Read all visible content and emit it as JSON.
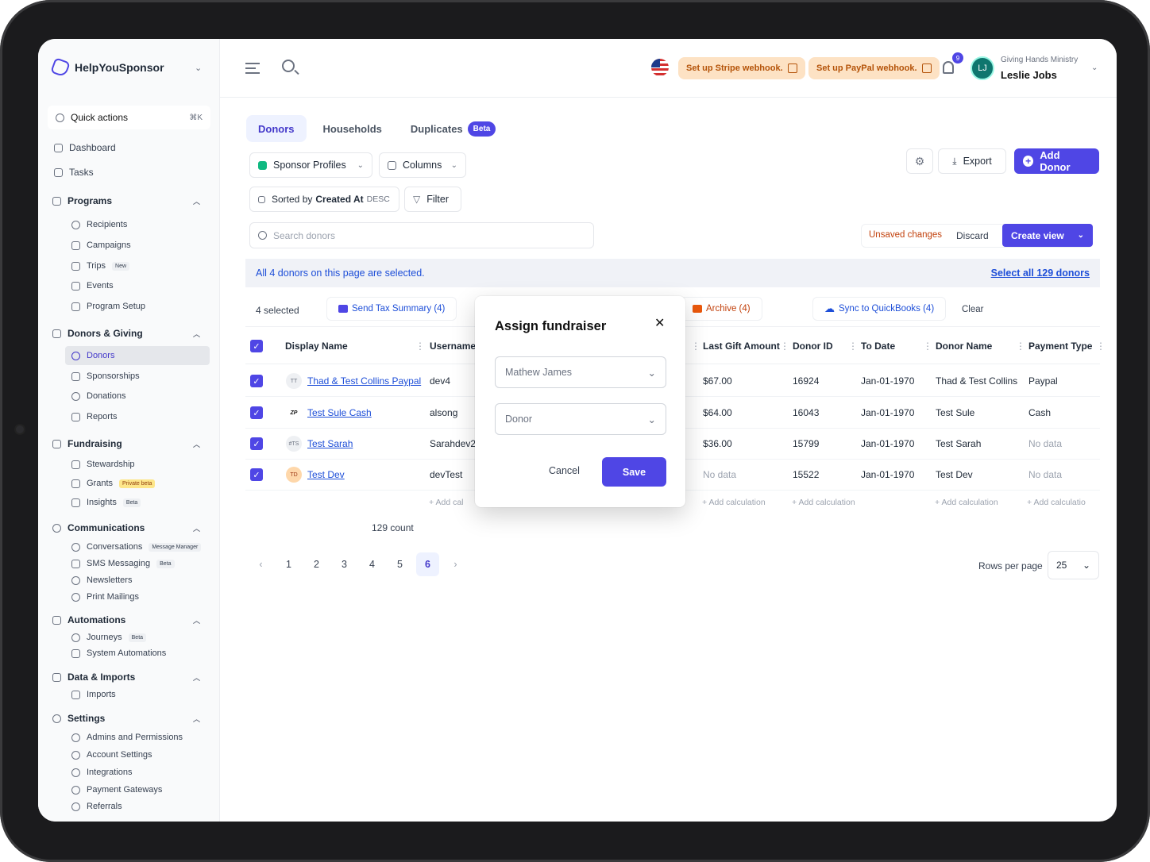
{
  "brand": {
    "name": "HelpYouSponsor"
  },
  "quick_actions": {
    "label": "Quick actions",
    "shortcut": "⌘K"
  },
  "sidebar": {
    "top": [
      {
        "label": "Dashboard"
      },
      {
        "label": "Tasks"
      }
    ],
    "programs": {
      "label": "Programs",
      "items": [
        {
          "label": "Recipients"
        },
        {
          "label": "Campaigns"
        },
        {
          "label": "Trips",
          "badge": "New"
        },
        {
          "label": "Events"
        },
        {
          "label": "Program Setup"
        }
      ]
    },
    "donors_giving": {
      "label": "Donors & Giving",
      "items": [
        {
          "label": "Donors"
        },
        {
          "label": "Sponsorships"
        },
        {
          "label": "Donations"
        },
        {
          "label": "Reports"
        }
      ]
    },
    "fundraising": {
      "label": "Fundraising",
      "items": [
        {
          "label": "Stewardship"
        },
        {
          "label": "Grants",
          "badge": "Private beta"
        },
        {
          "label": "Insights",
          "badge": "Beta"
        }
      ]
    },
    "communications": {
      "label": "Communications",
      "items": [
        {
          "label": "Conversations",
          "badge": "Message Manager"
        },
        {
          "label": "SMS Messaging",
          "badge": "Beta"
        },
        {
          "label": "Newsletters"
        },
        {
          "label": "Print Mailings"
        }
      ]
    },
    "automations": {
      "label": "Automations",
      "items": [
        {
          "label": "Journeys",
          "badge": "Beta"
        },
        {
          "label": "System Automations"
        }
      ]
    },
    "data_imports": {
      "label": "Data & Imports",
      "items": [
        {
          "label": "Imports"
        }
      ]
    },
    "settings": {
      "label": "Settings",
      "items": [
        {
          "label": "Admins and Permissions"
        },
        {
          "label": "Account Settings"
        },
        {
          "label": "Integrations"
        },
        {
          "label": "Payment Gateways"
        },
        {
          "label": "Referrals"
        }
      ]
    }
  },
  "header": {
    "stripe_webhook": "Set up Stripe webhook.",
    "paypal_webhook": "Set up PayPal webhook.",
    "notifications_count": "9",
    "avatar_initials": "LJ",
    "org_name": "Giving Hands Ministry",
    "user_name": "Leslie Jobs"
  },
  "tabs": [
    {
      "label": "Donors"
    },
    {
      "label": "Households"
    },
    {
      "label": "Duplicates",
      "badge": "Beta"
    }
  ],
  "toolbar": {
    "profiles": "Sponsor Profiles",
    "columns": "Columns",
    "sort_prefix": "Sorted by",
    "sort_field": "Created At",
    "sort_dir": "DESC",
    "filter": "Filter",
    "export": "Export",
    "add_donor": "Add Donor",
    "search_placeholder": "Search donors",
    "unsaved": "Unsaved changes",
    "discard": "Discard",
    "create_view": "Create view"
  },
  "selection": {
    "banner": "All 4 donors on this page are selected.",
    "select_all": "Select all 129 donors",
    "count": "4 selected",
    "send_tax": "Send Tax Summary (4)",
    "archive": "Archive (4)",
    "sync_qb": "Sync to QuickBooks (4)",
    "clear": "Clear"
  },
  "table": {
    "columns": [
      "Display Name",
      "Username",
      "Last Gift Amount",
      "Donor ID",
      "To Date",
      "Donor Name",
      "Payment Type"
    ],
    "rows": [
      {
        "avatar": "TT",
        "display": "Thad & Test Collins Paypal",
        "username": "dev4",
        "last_gift": "$67.00",
        "donor_id": "16924",
        "to_date": "Jan-01-1970",
        "donor_name": "Thad & Test Collins",
        "payment": "Paypal"
      },
      {
        "avatar": "ZP",
        "display": "Test Sule Cash",
        "username": "alsong",
        "last_gift": "$64.00",
        "donor_id": "16043",
        "to_date": "Jan-01-1970",
        "donor_name": "Test Sule",
        "payment": "Cash"
      },
      {
        "avatar": "#TS",
        "display": "Test Sarah",
        "username": "Sarahdev2",
        "last_gift": "$36.00",
        "donor_id": "15799",
        "to_date": "Jan-01-1970",
        "donor_name": "Test Sarah",
        "payment": "No data"
      },
      {
        "avatar": "TD",
        "display": "Test Dev",
        "username": "devTest",
        "last_gift": "No data",
        "donor_id": "15522",
        "to_date": "Jan-01-1970",
        "donor_name": "Test Dev",
        "payment": "No data"
      }
    ],
    "add_calc": "+ Add calculation",
    "add_calc_short": "+ Add cal",
    "add_calc_cut": "+ Add calculatio",
    "count": "129 count"
  },
  "pagination": {
    "pages": [
      "1",
      "2",
      "3",
      "4",
      "5",
      "6"
    ],
    "current": "6",
    "rows_label": "Rows per page",
    "rows_value": "25"
  },
  "modal": {
    "title": "Assign fundraiser",
    "fundraiser": "Mathew James",
    "role": "Donor",
    "cancel": "Cancel",
    "save": "Save"
  },
  "colors": {
    "accent": "#4f46e5",
    "warning_bg": "#fde2c4",
    "warning_text": "#b45309"
  }
}
